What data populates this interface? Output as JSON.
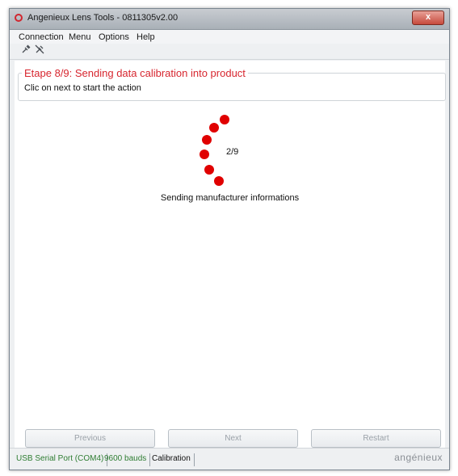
{
  "window": {
    "title": "Angenieux Lens Tools - 0811305v2.00",
    "close_label": "x"
  },
  "menu": {
    "items": [
      "Connection",
      "Menu",
      "Options",
      "Help"
    ]
  },
  "toolbar": {
    "icons": [
      "connect-plug-icon",
      "disconnect-plug-icon"
    ]
  },
  "step": {
    "title": "Etape 8/9: Sending data calibration into product",
    "subtitle": "Clic on next to start the action"
  },
  "progress": {
    "counter": "2/9",
    "message": "Sending manufacturer informations",
    "spinner_color": "#e00000"
  },
  "buttons": {
    "previous": "Previous",
    "next": "Next",
    "restart": "Restart"
  },
  "statusbar": {
    "port": "USB Serial Port (COM4)",
    "baud": "9600 bauds",
    "mode": "Calibration",
    "brand": "angénieux"
  },
  "colors": {
    "accent": "#d7262f",
    "status_green": "#2e7d32"
  }
}
